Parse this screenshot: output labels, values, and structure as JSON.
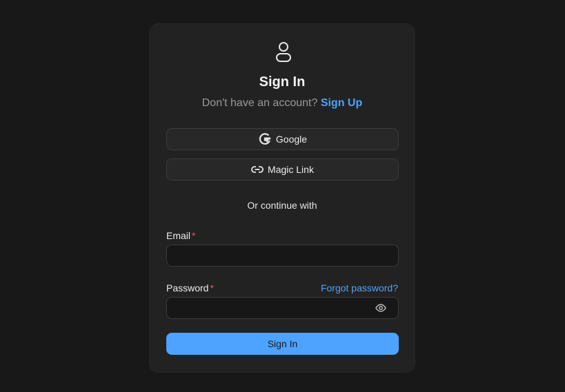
{
  "header": {
    "icon": "user-icon",
    "title": "Sign In",
    "subtitle_text": "Don't have an account?",
    "signup_link": "Sign Up"
  },
  "oauth": {
    "google": {
      "label": "Google",
      "icon": "google-icon"
    },
    "magic": {
      "label": "Magic Link",
      "icon": "link-icon"
    }
  },
  "divider": "Or continue with",
  "form": {
    "email": {
      "label": "Email",
      "required_mark": "*",
      "value": ""
    },
    "password": {
      "label": "Password",
      "required_mark": "*",
      "value": "",
      "toggle_icon": "eye-icon"
    },
    "forgot_link": "Forgot password?",
    "submit_label": "Sign In"
  },
  "colors": {
    "background": "#181818",
    "card": "#222222",
    "accent": "#4da3ff",
    "required": "#e05a6a"
  }
}
